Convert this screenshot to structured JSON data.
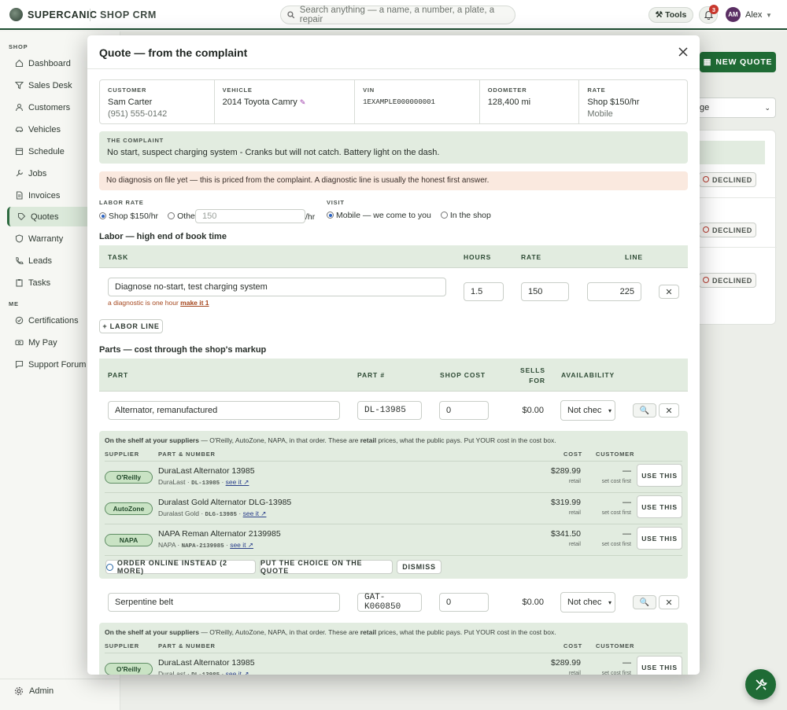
{
  "brand": "SUPERCANIC",
  "app": "SHOP CRM",
  "search_placeholder": "Search anything — a name, a number, a plate, a repair",
  "tools_label": "Tools",
  "notif_count": "3",
  "user": {
    "initials": "AM",
    "name": "Alex"
  },
  "sidebar": {
    "shop_label": "SHOP",
    "items": [
      "Dashboard",
      "Sales Desk",
      "Customers",
      "Vehicles",
      "Schedule",
      "Jobs",
      "Invoices",
      "Quotes",
      "Warranty",
      "Leads",
      "Tasks"
    ],
    "me_label": "ME",
    "me_items": [
      "Certifications",
      "My Pay",
      "Support Forum"
    ],
    "admin": "Admin"
  },
  "background": {
    "new_quote": "NEW QUOTE",
    "select_value": "ge",
    "declined": "DECLINED"
  },
  "modal": {
    "title": "Quote — from the complaint",
    "customer": {
      "label": "CUSTOMER",
      "name": "Sam Carter",
      "phone": "(951) 555-0142"
    },
    "vehicle": {
      "label": "VEHICLE",
      "value": "2014 Toyota Camry"
    },
    "vin": {
      "label": "VIN",
      "value": "1EXAMPLE000000001"
    },
    "odometer": {
      "label": "ODOMETER",
      "value": "128,400 mi"
    },
    "rate": {
      "label": "RATE",
      "value": "Shop $150/hr",
      "sub": "Mobile"
    },
    "complaint": {
      "label": "THE COMPLAINT",
      "text": "No start, suspect charging system - Cranks but will not catch. Battery light on the dash."
    },
    "notice": "No diagnosis on file yet — this is priced from the complaint. A diagnostic line is usually the honest first answer.",
    "labor_rate": {
      "label": "LABOR RATE",
      "shop": "Shop $150/hr",
      "other": "Other",
      "other_value": "150",
      "unit": "/hr"
    },
    "visit": {
      "label": "VISIT",
      "mobile": "Mobile — we come to you",
      "shop": "In the shop"
    },
    "labor": {
      "heading": "Labor — high end of book time",
      "cols": {
        "task": "TASK",
        "hours": "HOURS",
        "rate": "RATE",
        "line": "LINE"
      },
      "row": {
        "task": "Diagnose no-start, test charging system",
        "hours": "1.5",
        "rate": "150",
        "line": "225",
        "hint": "a diagnostic is one hour",
        "hint_link": "make it 1"
      },
      "add": "+ LABOR LINE"
    },
    "parts": {
      "heading": "Parts — cost through the shop's markup",
      "cols": {
        "part": "PART",
        "partno": "PART #",
        "shop_cost": "SHOP COST",
        "sells_for_1": "SELLS",
        "sells_for_2": "FOR",
        "availability": "AVAILABILITY"
      },
      "rows": [
        {
          "part": "Alternator, remanufactured",
          "partno": "DL-13985",
          "cost": "0",
          "sells": "$0.00",
          "avail": "Not chec"
        },
        {
          "part": "Serpentine belt",
          "partno": "GAT-K060850",
          "cost": "0",
          "sells": "$0.00",
          "avail": "Not chec"
        }
      ],
      "shelf": {
        "hint_bold": "On the shelf at your suppliers",
        "hint_rest": " — O'Reilly, AutoZone, NAPA, in that order. These are ",
        "hint_retail": "retail",
        "hint_end": " prices, what the public pays. Put YOUR cost in the cost box.",
        "cols": {
          "supplier": "SUPPLIER",
          "part": "PART & NUMBER",
          "cost": "COST",
          "customer": "CUSTOMER"
        },
        "results": [
          {
            "supplier": "O'Reilly",
            "name": "DuraLast Alternator 13985",
            "brand": "DuraLast",
            "num": "DL-13985",
            "cost": "$289.99"
          },
          {
            "supplier": "AutoZone",
            "name": "Duralast Gold Alternator DLG-13985",
            "brand": "Duralast Gold",
            "num": "DLG-13985",
            "cost": "$319.99"
          },
          {
            "supplier": "NAPA",
            "name": "NAPA Reman Alternator 2139985",
            "brand": "NAPA",
            "num": "NAPA-2139985",
            "cost": "$341.50"
          }
        ],
        "retail": "retail",
        "dash": "—",
        "set_cost": "set cost first",
        "see_it": "see it ↗",
        "use_this": "USE THIS",
        "order_online": "ORDER ONLINE INSTEAD (2 MORE)",
        "put_choice": "PUT THE CHOICE ON THE QUOTE",
        "dismiss": "DISMISS"
      }
    }
  }
}
